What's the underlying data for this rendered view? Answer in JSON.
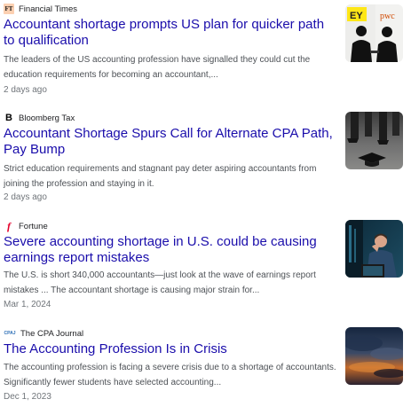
{
  "articles": [
    {
      "source": "Financial Times",
      "logo_text": "FT",
      "logo_icon": "ft-logo-icon",
      "headline": "Accountant shortage prompts US plan for quicker path to qualification",
      "snippet": "The leaders of the US accounting profession have signalled they could cut the education requirements for becoming an accountant,...",
      "date": "2 days ago",
      "thumbnail_text": [
        "EY",
        "pwc"
      ]
    },
    {
      "source": "Bloomberg Tax",
      "logo_text": "B",
      "logo_icon": "bloomberg-logo-icon",
      "headline": "Accountant Shortage Spurs Call for Alternate CPA Path, Pay Bump",
      "snippet": "Strict education requirements and stagnant pay deter aspiring accountants from joining the profession and staying in it.",
      "date": "2 days ago"
    },
    {
      "source": "Fortune",
      "logo_text": "f",
      "logo_icon": "fortune-logo-icon",
      "headline": "Severe accounting shortage in U.S. could be causing earnings report mistakes",
      "snippet": "The U.S. is short 340,000 accountants—just look at the wave of earnings report mistakes ... The accountant shortage is causing major strain for...",
      "date": "Mar 1, 2024"
    },
    {
      "source": "The CPA Journal",
      "logo_text": "CPAJ",
      "logo_icon": "cpa-journal-logo-icon",
      "headline": "The Accounting Profession Is in Crisis",
      "snippet": "The accounting profession is facing a severe crisis due to a shortage of accountants. Significantly fewer students have selected accounting...",
      "date": "Dec 1, 2023"
    }
  ],
  "colors": {
    "headline": "#1a0dab",
    "snippet": "#4d5156",
    "date": "#70757a",
    "ft_pink": "#fcd0b1",
    "fortune_red": "#e4002b",
    "cpa_blue": "#2a6db5"
  }
}
